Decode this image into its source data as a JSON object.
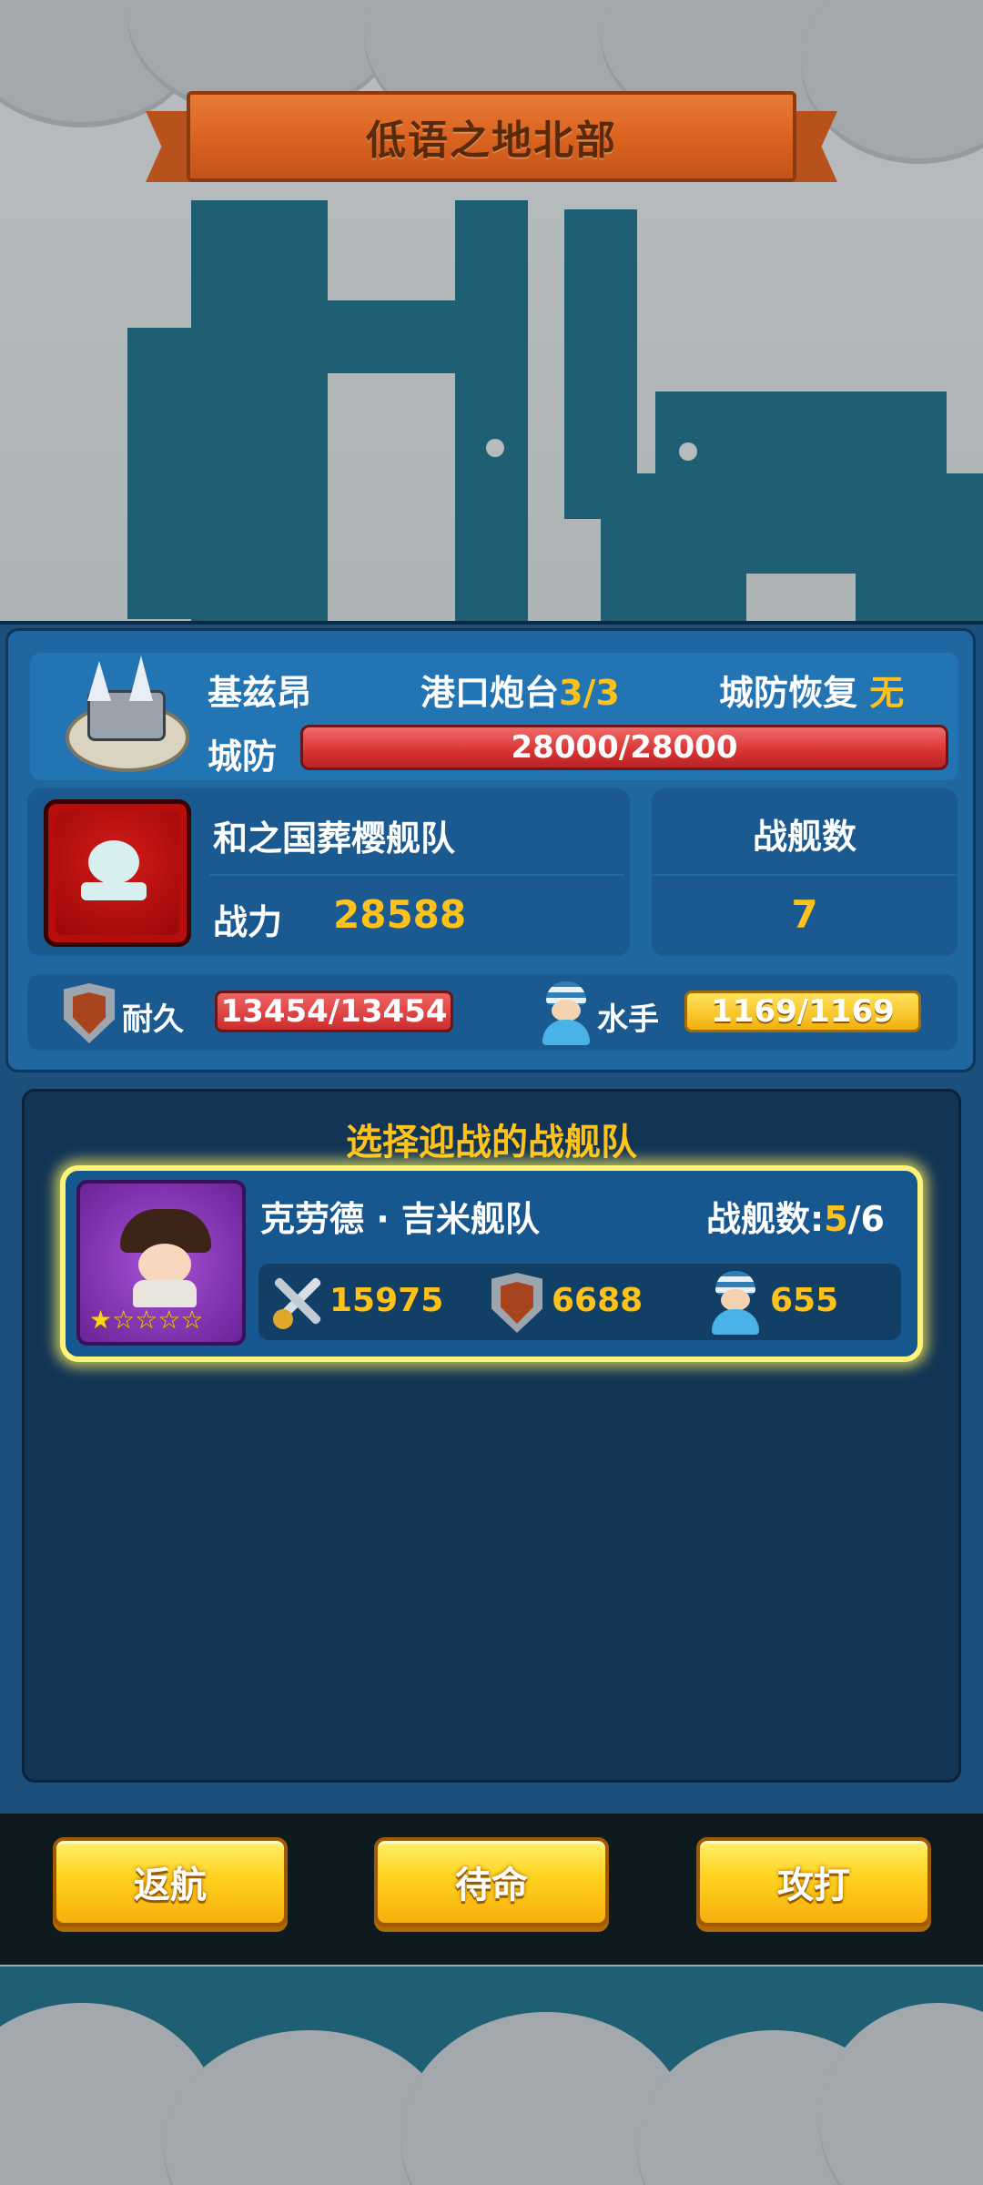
{
  "location_title": "低语之地北部",
  "city": {
    "name": "基兹昂",
    "harbor_cannon_label": "港口炮台",
    "harbor_cannon_value": "3/3",
    "defense_recovery_label": "城防恢复",
    "defense_recovery_value": "无",
    "defense_label": "城防",
    "defense_value": "28000/28000",
    "defense_fraction": 1.0
  },
  "enemy_fleet": {
    "name": "和之国葬樱舰队",
    "power_label": "战力",
    "power_value": "28588",
    "ship_count_label": "战舰数",
    "ship_count_value": "7",
    "durability_label": "耐久",
    "durability_value": "13454/13454",
    "sailor_label": "水手",
    "sailor_value": "1169/1169"
  },
  "selection": {
    "title": "选择迎战的战舰队",
    "fleets": [
      {
        "name": "克劳德 · 吉米舰队",
        "ship_count_label": "战舰数:",
        "ship_count_current": "5",
        "ship_count_total": "/6",
        "stars_text": "★☆☆☆☆",
        "stars": 1,
        "attack": "15975",
        "durability": "6688",
        "sailors": "655"
      }
    ]
  },
  "buttons": {
    "return_label": "返航",
    "standby_label": "待命",
    "attack_label": "攻打"
  },
  "colors": {
    "accent_yellow": "#ffc21a",
    "panel_blue": "#1f67a1",
    "hp_red": "#d83232"
  }
}
